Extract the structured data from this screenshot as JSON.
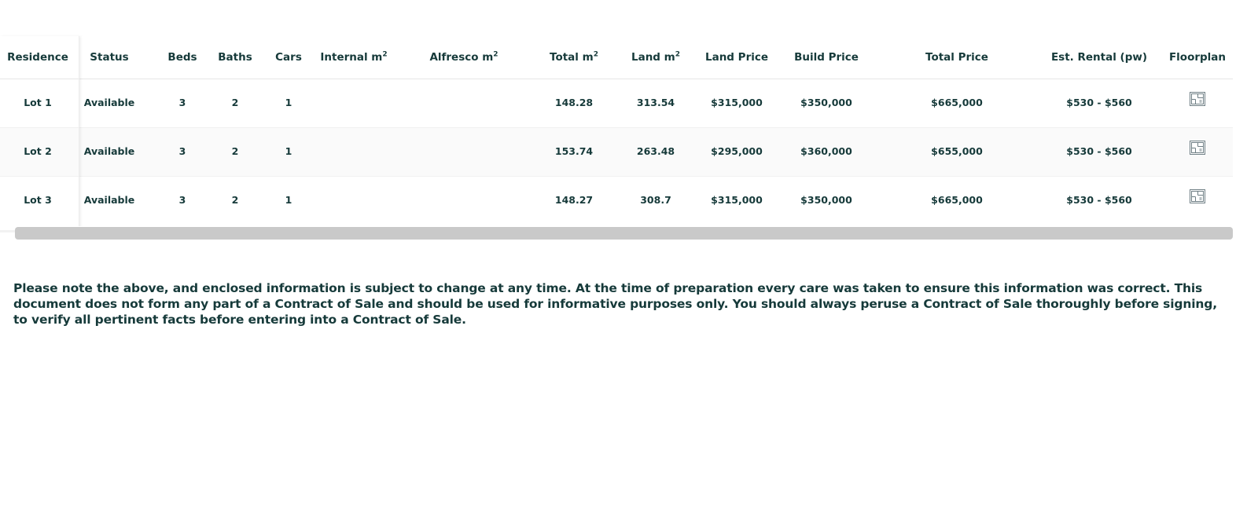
{
  "table": {
    "headers": {
      "residence": "Residence",
      "status": "Status",
      "beds": "Beds",
      "baths": "Baths",
      "cars": "Cars",
      "internal": "Internal m",
      "alfresco": "Alfresco m",
      "total_area": "Total m",
      "land_area": "Land m",
      "squared": "2",
      "land_price": "Land Price",
      "build_price": "Build Price",
      "total_price": "Total Price",
      "rental": "Est. Rental (pw)",
      "floorplan": "Floorplan"
    },
    "rows": [
      {
        "residence": "Lot 1",
        "status": "Available",
        "beds": "3",
        "baths": "2",
        "cars": "1",
        "internal": "",
        "alfresco": "",
        "total_area": "148.28",
        "land_area": "313.54",
        "land_price": "$315,000",
        "build_price": "$350,000",
        "total_price": "$665,000",
        "rental": "$530 - $560",
        "floorplan_icon": "floorplan-icon"
      },
      {
        "residence": "Lot 2",
        "status": "Available",
        "beds": "3",
        "baths": "2",
        "cars": "1",
        "internal": "",
        "alfresco": "",
        "total_area": "153.74",
        "land_area": "263.48",
        "land_price": "$295,000",
        "build_price": "$360,000",
        "total_price": "$655,000",
        "rental": "$530 - $560",
        "floorplan_icon": "floorplan-icon"
      },
      {
        "residence": "Lot 3",
        "status": "Available",
        "beds": "3",
        "baths": "2",
        "cars": "1",
        "internal": "",
        "alfresco": "",
        "total_area": "148.27",
        "land_area": "308.7",
        "land_price": "$315,000",
        "build_price": "$350,000",
        "total_price": "$665,000",
        "rental": "$530 - $560",
        "floorplan_icon": "floorplan-icon"
      }
    ]
  },
  "disclaimer": "Please note the above, and enclosed information is subject to change at any time. At the time of preparation every care was taken to ensure this information was correct. This document does not form any part of a Contract of Sale and should be used for informative purposes only. You should always peruse a Contract of Sale thoroughly before signing, to verify all pertinent facts before entering into a Contract of Sale.",
  "colors": {
    "text": "#163a3a",
    "scrollbar": "#c9c9c9",
    "row_alt": "#fafafa"
  }
}
